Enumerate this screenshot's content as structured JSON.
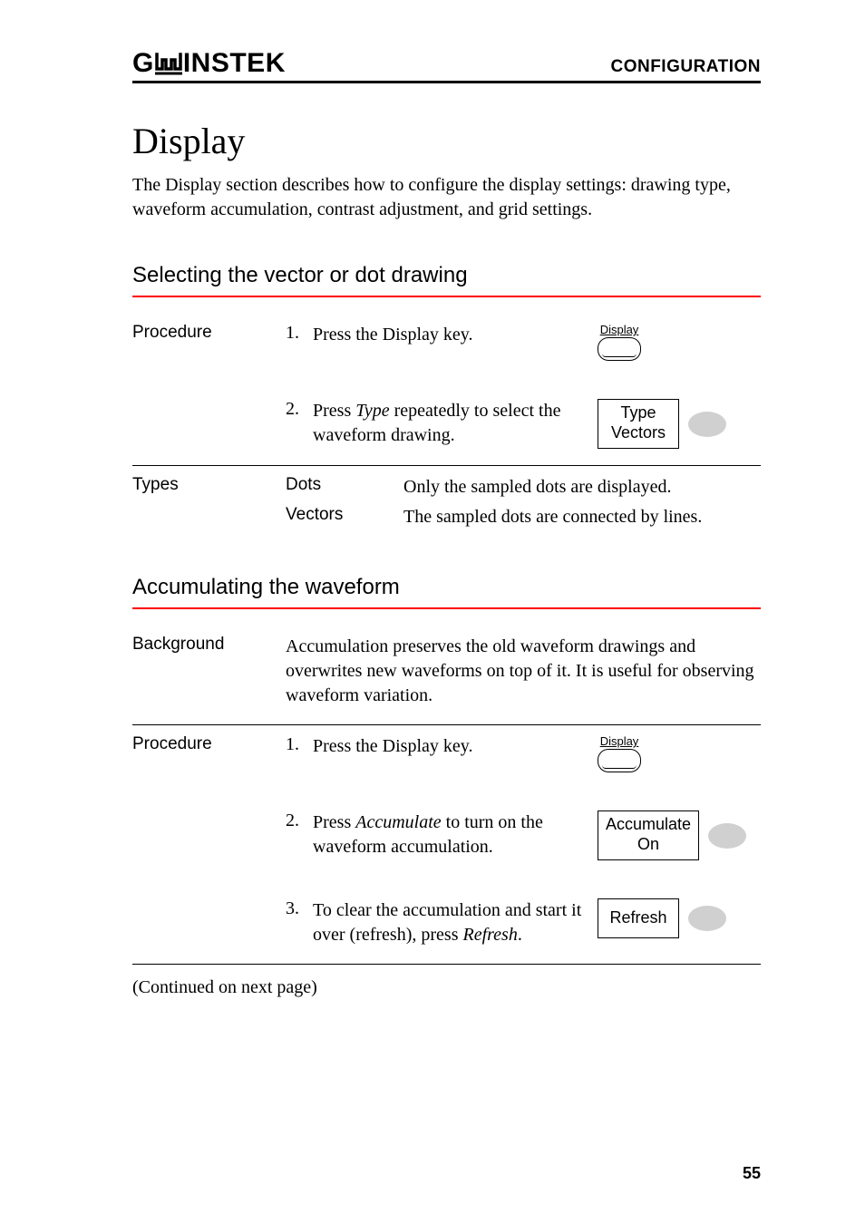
{
  "header": {
    "logo_left": "G",
    "logo_right": "INSTEK",
    "title": "CONFIGURATION"
  },
  "main": {
    "title": "Display",
    "intro": "The Display section describes how to configure the display settings: drawing type, waveform accumulation, contrast adjustment, and grid settings."
  },
  "section1": {
    "title": "Selecting the vector or dot drawing",
    "procedure_label": "Procedure",
    "step1_num": "1.",
    "step1_text": "Press the Display key.",
    "display_key_label": "Display",
    "step2_num": "2.",
    "step2_text_a": "Press ",
    "step2_text_italic": "Type",
    "step2_text_b": " repeatedly to select the waveform drawing.",
    "softkey_type_line1": "Type",
    "softkey_type_line2": "Vectors",
    "types_label": "Types",
    "type_dots": "Dots",
    "type_dots_desc": "Only the sampled dots are displayed.",
    "type_vectors": "Vectors",
    "type_vectors_desc": "The sampled dots are connected by lines."
  },
  "section2": {
    "title": "Accumulating the waveform",
    "background_label": "Background",
    "background_text": "Accumulation preserves the old waveform drawings and overwrites new waveforms on top of it. It is useful for observing waveform variation.",
    "procedure_label": "Procedure",
    "step1_num": "1.",
    "step1_text": "Press the Display key.",
    "display_key_label": "Display",
    "step2_num": "2.",
    "step2_text_a": "Press ",
    "step2_text_italic": "Accumulate",
    "step2_text_b": " to turn on the waveform accumulation.",
    "softkey_accum_line1": "Accumulate",
    "softkey_accum_line2": "On",
    "step3_num": "3.",
    "step3_text_a": "To clear the accumulation and start it over (refresh), press ",
    "step3_text_italic": "Refresh",
    "step3_text_b": ".",
    "softkey_refresh": "Refresh"
  },
  "continued": "(Continued on next page)",
  "page_num": "55"
}
